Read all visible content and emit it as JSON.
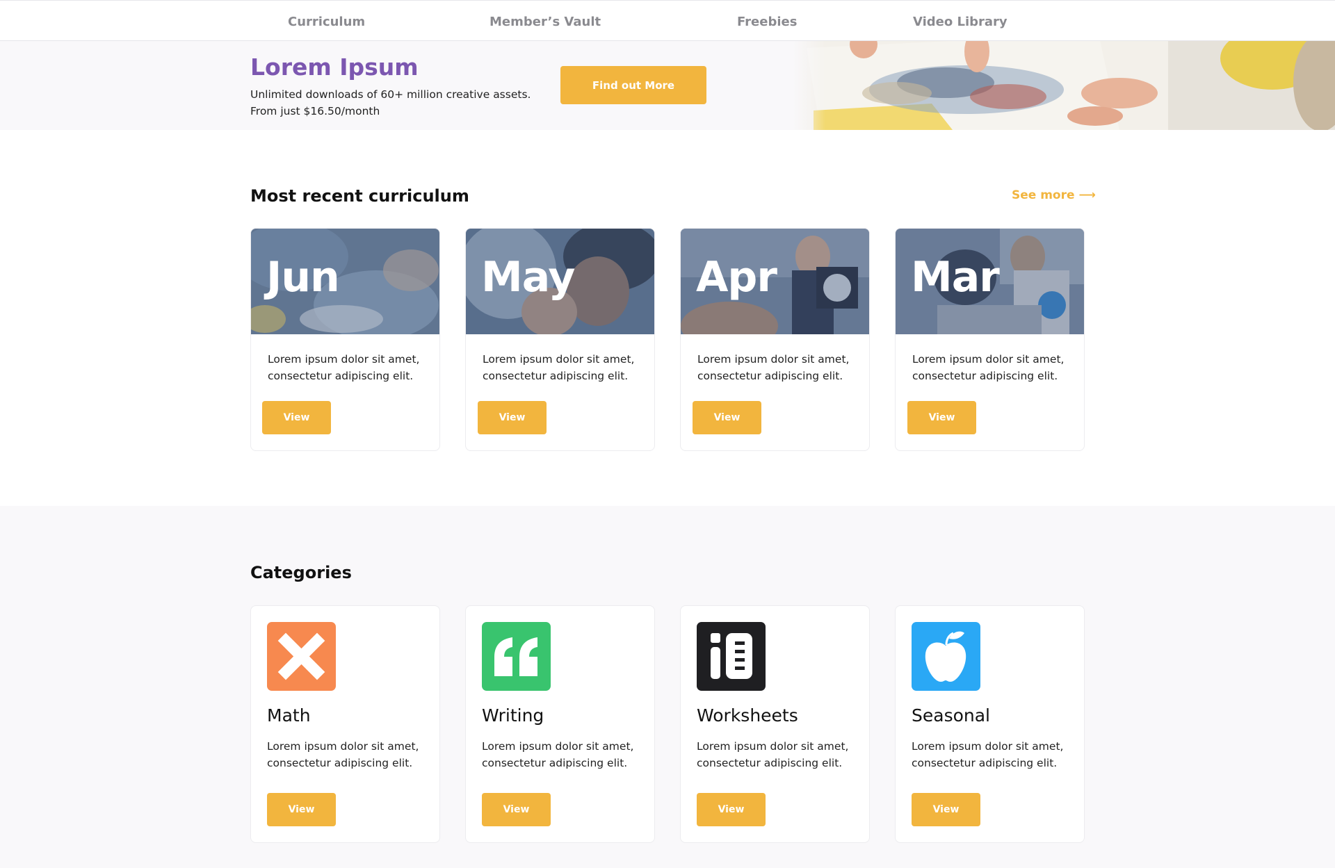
{
  "nav": {
    "items": [
      "Curriculum",
      "Member’s Vault",
      "Freebies",
      "Video Library"
    ]
  },
  "banner": {
    "title": "Lorem Ipsum",
    "line1": "Unlimited downloads of 60+ million creative assets.",
    "line2": "From just $16.50/month",
    "cta": "Find out More"
  },
  "recent": {
    "title": "Most recent curriculum",
    "see_more": "See more ⟶",
    "cards": [
      {
        "month": "Jun",
        "line1": "Lorem ipsum dolor sit amet,",
        "line2": "consectetur adipiscing elit.",
        "button": "View"
      },
      {
        "month": "May",
        "line1": "Lorem ipsum dolor sit amet,",
        "line2": "consectetur adipiscing elit.",
        "button": "View"
      },
      {
        "month": "Apr",
        "line1": "Lorem ipsum dolor sit amet,",
        "line2": "consectetur adipiscing elit.",
        "button": "View"
      },
      {
        "month": "Mar",
        "line1": "Lorem ipsum dolor sit amet,",
        "line2": "consectetur adipiscing elit.",
        "button": "View"
      }
    ]
  },
  "categories": {
    "title": "Categories",
    "cards": [
      {
        "name": "Math",
        "icon": "multiply-icon",
        "color": "#f7894f",
        "line1": "Lorem ipsum dolor sit amet,",
        "line2": "consectetur adipiscing elit.",
        "button": "View"
      },
      {
        "name": "Writing",
        "icon": "quote-icon",
        "color": "#39c46e",
        "line1": "Lorem ipsum dolor sit amet,",
        "line2": "consectetur adipiscing elit.",
        "button": "View"
      },
      {
        "name": "Worksheets",
        "icon": "worksheet-icon",
        "color": "#1f1f22",
        "line1": "Lorem ipsum dolor sit amet,",
        "line2": "consectetur adipiscing elit.",
        "button": "View"
      },
      {
        "name": "Seasonal",
        "icon": "apple-icon",
        "color": "#2aa8f5",
        "line1": "Lorem ipsum dolor sit amet,",
        "line2": "consectetur adipiscing elit.",
        "button": "View"
      }
    ]
  },
  "colors": {
    "accent": "#f2b53e",
    "brand_purple": "#7c57b0"
  }
}
